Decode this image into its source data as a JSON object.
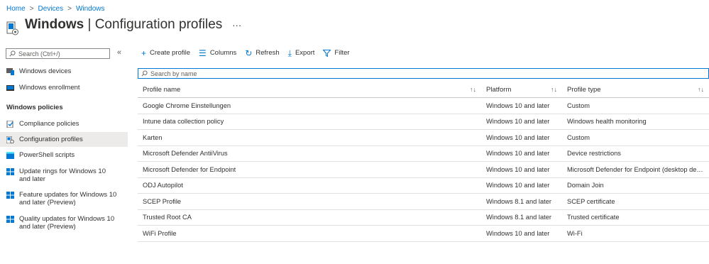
{
  "breadcrumb": [
    "Home",
    "Devices",
    "Windows"
  ],
  "title": {
    "bold": "Windows",
    "rest": " | Configuration profiles",
    "more": "···"
  },
  "sidebar": {
    "search_placeholder": "Search (Ctrl+/)",
    "collapse": "«",
    "items_top": [
      {
        "label": "Windows devices",
        "icon": "devices-icon"
      },
      {
        "label": "Windows enrollment",
        "icon": "enrollment-icon"
      }
    ],
    "section_header": "Windows policies",
    "items": [
      {
        "label": "Compliance policies",
        "icon": "compliance-icon"
      },
      {
        "label": "Configuration profiles",
        "icon": "configuration-icon",
        "active": true
      },
      {
        "label": "PowerShell scripts",
        "icon": "powershell-icon"
      },
      {
        "label": "Update rings for Windows 10 and later",
        "icon": "windows-icon"
      },
      {
        "label": "Feature updates for Windows 10 and later (Preview)",
        "icon": "windows-icon"
      },
      {
        "label": "Quality updates for Windows 10 and later (Preview)",
        "icon": "windows-icon"
      }
    ]
  },
  "toolbar": {
    "create": "Create profile",
    "columns": "Columns",
    "refresh": "Refresh",
    "export": "Export",
    "filter": "Filter"
  },
  "search_placeholder": "Search by name",
  "table": {
    "headers": [
      "Profile name",
      "Platform",
      "Profile type"
    ],
    "rows": [
      [
        "Google Chrome Einstellungen",
        "Windows 10 and later",
        "Custom"
      ],
      [
        "Intune data collection policy",
        "Windows 10 and later",
        "Windows health monitoring"
      ],
      [
        "Karten",
        "Windows 10 and later",
        "Custom"
      ],
      [
        "Microsoft Defender AntiiVirus",
        "Windows 10 and later",
        "Device restrictions"
      ],
      [
        "Microsoft Defender for Endpoint",
        "Windows 10 and later",
        "Microsoft Defender for Endpoint (desktop devic..."
      ],
      [
        "ODJ Autopilot",
        "Windows 10 and later",
        "Domain Join"
      ],
      [
        "SCEP Profile",
        "Windows 8.1 and later",
        "SCEP certificate"
      ],
      [
        "Trusted Root CA",
        "Windows 8.1 and later",
        "Trusted certificate"
      ],
      [
        "WiFi Profile",
        "Windows 10 and later",
        "Wi-Fi"
      ]
    ]
  },
  "colors": {
    "accent": "#0078d4",
    "active_bg": "#edebe9",
    "text": "#323130"
  }
}
